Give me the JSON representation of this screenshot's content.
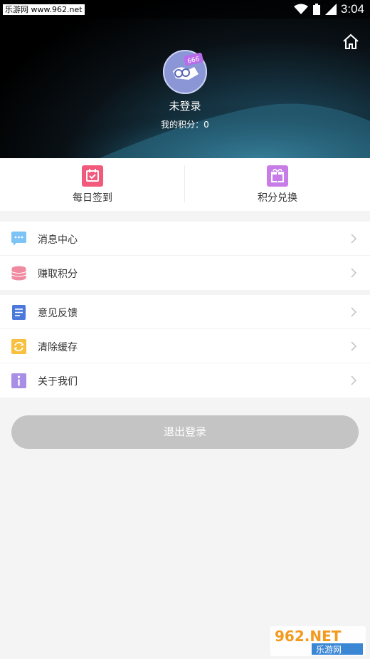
{
  "status_bar": {
    "watermark": "乐游网 www.962.net",
    "time": "3:04"
  },
  "profile": {
    "username": "未登录",
    "points_label": "我的积分：0",
    "avatar_badge": "666"
  },
  "quick_actions": [
    {
      "label": "每日签到",
      "icon": "calendar-check-icon",
      "color": "#f25a7d"
    },
    {
      "label": "积分兑换",
      "icon": "gift-icon",
      "color": "#c87ce8"
    }
  ],
  "menu": {
    "group1": [
      {
        "label": "消息中心",
        "icon": "chat-icon",
        "color": "#7cc3f6"
      },
      {
        "label": "赚取积分",
        "icon": "coins-icon",
        "color": "#f08aa0"
      }
    ],
    "group2": [
      {
        "label": "意见反馈",
        "icon": "document-icon",
        "color": "#4a78db"
      },
      {
        "label": "清除缓存",
        "icon": "refresh-icon",
        "color": "#f7c03f"
      },
      {
        "label": "关于我们",
        "icon": "info-icon",
        "color": "#a98ee6"
      }
    ]
  },
  "logout_label": "退出登录",
  "watermark_bottom": {
    "top": "962.NET",
    "bottom": "乐游网"
  }
}
